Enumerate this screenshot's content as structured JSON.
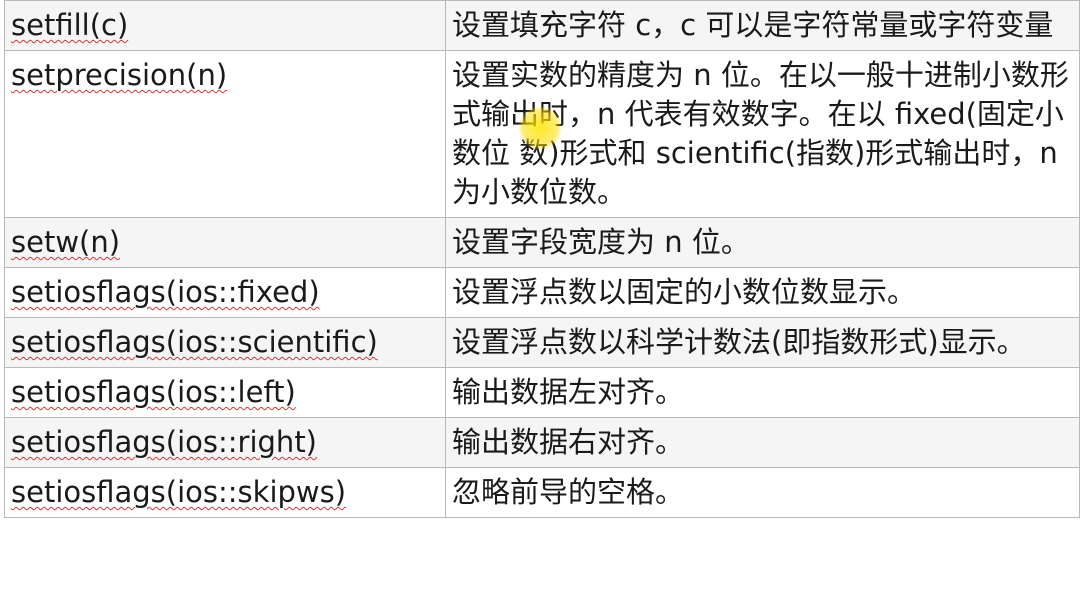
{
  "table": {
    "rows": [
      {
        "func": "setfill(c)",
        "desc": "设置填充字符 c，c 可以是字符常量或字符变量"
      },
      {
        "func": "setprecision(n)",
        "desc": "设置实数的精度为 n 位。在以一般十进制小数形式输出时，n 代表有效数字。在以 fixed(固定小数位 数)形式和 scientific(指数)形式输出时，n 为小数位数。"
      },
      {
        "func": "setw(n)",
        "desc": "设置字段宽度为 n 位。"
      },
      {
        "func": "setiosflags(ios::fixed)",
        "desc": "设置浮点数以固定的小数位数显示。"
      },
      {
        "func": "setiosflags(ios::scientific)",
        "desc": "设置浮点数以科学计数法(即指数形式)显示。"
      },
      {
        "func": "setiosflags(ios::left)",
        "desc": "输出数据左对齐。"
      },
      {
        "func": "setiosflags(ios::right)",
        "desc": "输出数据右对齐。"
      },
      {
        "func": "setiosflags(ios::skipws)",
        "desc": "忽略前导的空格。"
      }
    ]
  },
  "colors": {
    "border": "#b9b9b9",
    "row_alt": "#f5f5f5",
    "spellcheck": "#d23a3a",
    "cursor_highlight": "#ffe600"
  }
}
